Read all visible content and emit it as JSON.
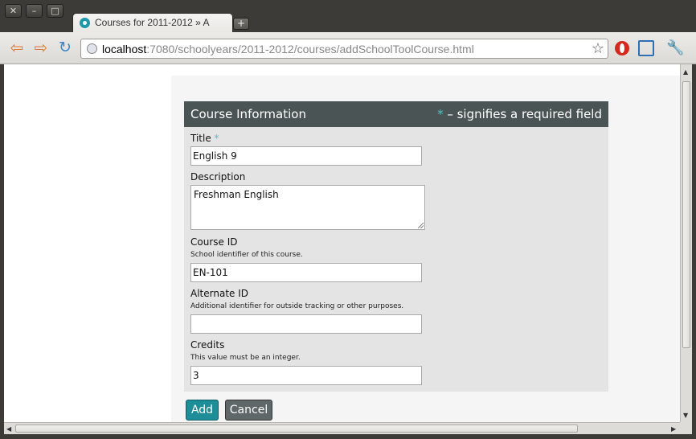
{
  "window": {
    "close_glyph": "✕",
    "minimize_glyph": "–",
    "maximize_glyph": "□"
  },
  "tab": {
    "title": "Courses for 2011-2012 » A",
    "new_tab_glyph": "+"
  },
  "toolbar": {
    "back_glyph": "⇦",
    "forward_glyph": "⇨",
    "reload_glyph": "↻",
    "url_host": "localhost",
    "url_rest": ":7080/schoolyears/2011-2012/courses/addSchoolToolCourse.html",
    "star_glyph": "☆",
    "wrench_glyph": "🔧"
  },
  "form": {
    "legend_title": "Course Information",
    "required_mark": "*",
    "required_note": " – signifies a required field",
    "title_label": "Title",
    "title_value": "English 9",
    "description_label": "Description",
    "description_value": "Freshman English",
    "course_id_label": "Course ID",
    "course_id_hint": "School identifier of this course.",
    "course_id_value": "EN-101",
    "alt_id_label": "Alternate ID",
    "alt_id_hint": "Additional identifier for outside tracking or other purposes.",
    "alt_id_value": "",
    "credits_label": "Credits",
    "credits_hint": "This value must be an integer.",
    "credits_value": "3",
    "add_label": "Add",
    "cancel_label": "Cancel"
  },
  "scrollbars": {
    "up_glyph": "▲",
    "down_glyph": "▼",
    "left_glyph": "◀",
    "right_glyph": "▶",
    "grip_glyph": "≡"
  },
  "colors": {
    "legend_bg": "#4b5455",
    "required_accent": "#4fc3c3",
    "add_button": "#1d8d98",
    "cancel_button": "#5f6768"
  }
}
